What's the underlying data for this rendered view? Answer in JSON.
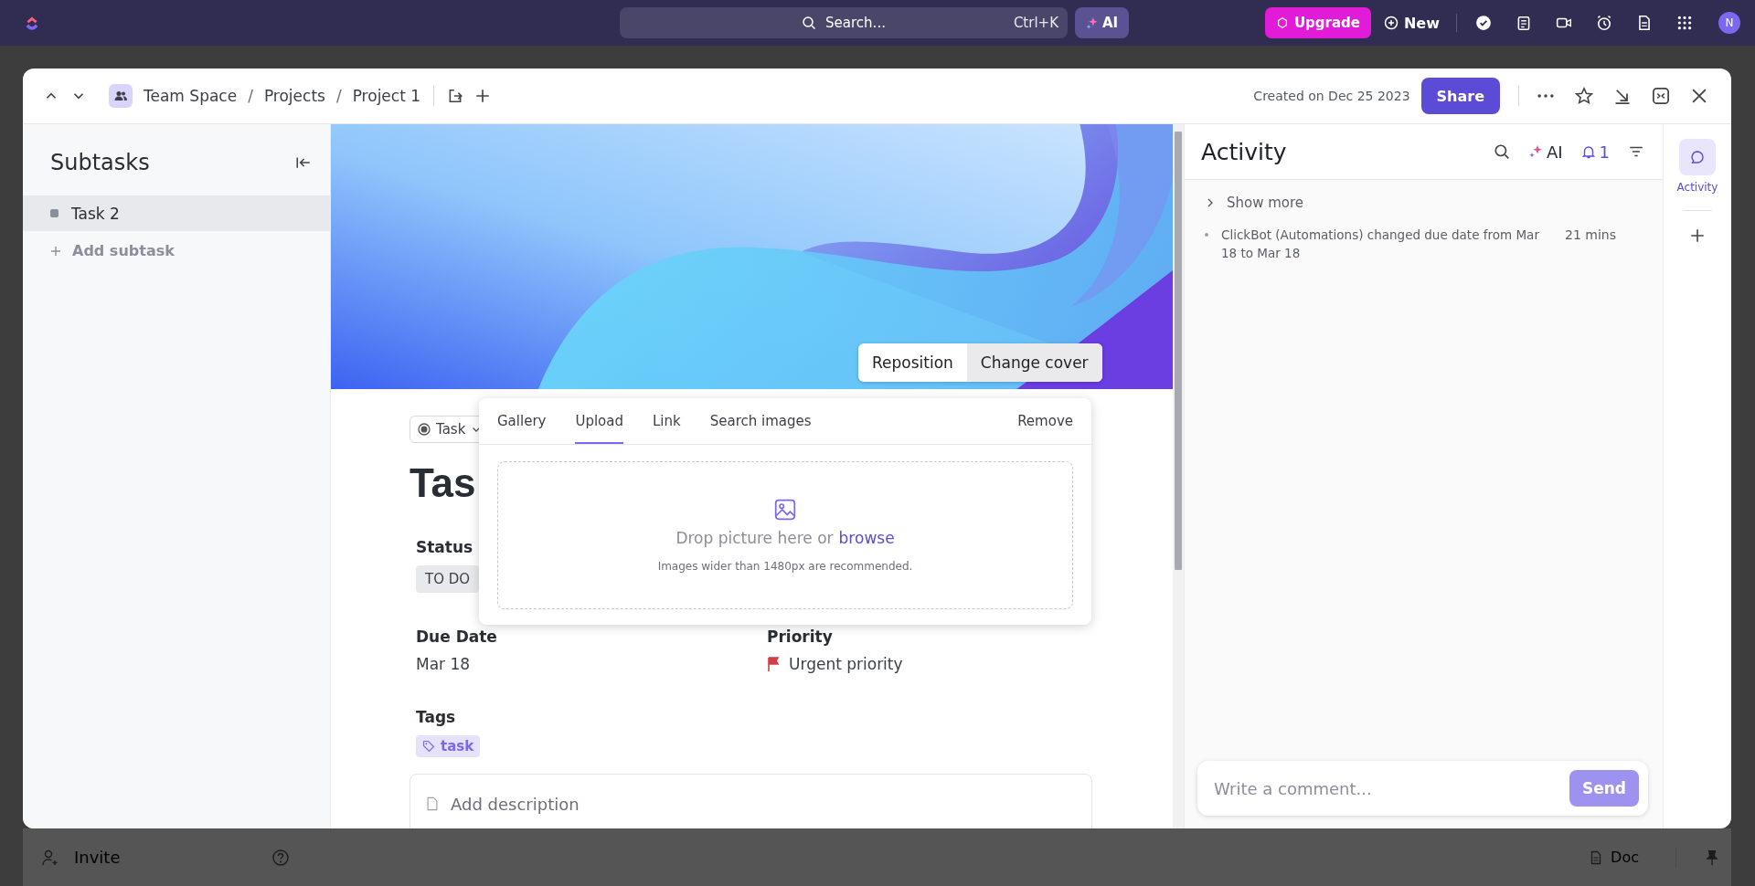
{
  "topbar": {
    "search": {
      "placeholder": "Search...",
      "shortcut": "Ctrl+K"
    },
    "ai_label": "AI",
    "upgrade": "Upgrade",
    "new": "New",
    "avatar": "N"
  },
  "header": {
    "breadcrumb": [
      {
        "kind": "link",
        "text": "Team Space"
      },
      {
        "kind": "separator",
        "text": "/"
      },
      {
        "kind": "link",
        "text": "Projects"
      },
      {
        "kind": "separator",
        "text": "/"
      },
      {
        "kind": "link",
        "text": "Project 1"
      }
    ],
    "created": "Created on Dec 25 2023",
    "share": "Share"
  },
  "subtasks": {
    "title": "Subtasks",
    "items": [
      {
        "name": "Task 2",
        "selected": true
      }
    ],
    "add": "Add subtask"
  },
  "cover": {
    "buttons": [
      "Reposition",
      "Change cover"
    ]
  },
  "task": {
    "type": "Task",
    "title": "Tas",
    "fields": [
      {
        "label": "Status",
        "kind": "status",
        "value": "TO DO"
      },
      {
        "label": "Due Date",
        "kind": "date",
        "value": "Mar 18"
      },
      {
        "label": "Priority",
        "kind": "priority",
        "value": "Urgent priority",
        "color": "#d33d44"
      }
    ],
    "tags_label": "Tags",
    "tags": [
      "task"
    ],
    "description_placeholder": "Add description"
  },
  "cover_popup": {
    "tabs": [
      {
        "label": "Gallery",
        "selected": false
      },
      {
        "label": "Upload",
        "selected": true
      },
      {
        "label": "Link",
        "selected": false
      },
      {
        "label": "Search images",
        "selected": false
      }
    ],
    "remove": "Remove",
    "drop_text": "Drop picture here or",
    "browse_link": "browse",
    "hint": "Images wider than 1480px are recommended."
  },
  "activity": {
    "title": "Activity",
    "ai": "AI",
    "notifications": "1",
    "show_more": "Show more",
    "entries": [
      {
        "text": "ClickBot (Automations) changed due date from Mar 18 to Mar 18",
        "time": "21 mins"
      }
    ],
    "comment_placeholder": "Write a comment...",
    "send": "Send"
  },
  "rail": {
    "items": [
      {
        "label": "Activity",
        "selected": true
      }
    ]
  },
  "bottom": {
    "invite": "Invite",
    "doc": "Doc"
  }
}
